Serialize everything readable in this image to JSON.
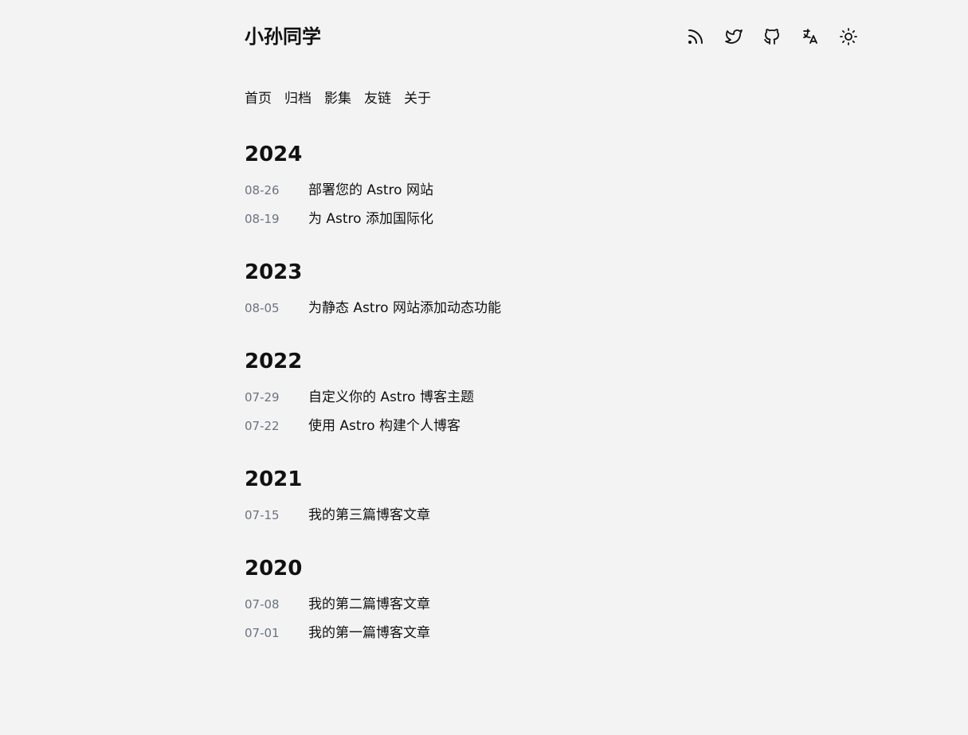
{
  "header": {
    "site_title": "小孙同学",
    "icons": [
      "rss-icon",
      "twitter-icon",
      "github-icon",
      "translate-icon",
      "sun-icon"
    ]
  },
  "nav": {
    "items": [
      {
        "label": "首页"
      },
      {
        "label": "归档"
      },
      {
        "label": "影集"
      },
      {
        "label": "友链"
      },
      {
        "label": "关于"
      }
    ]
  },
  "archive": {
    "years": [
      {
        "year": "2024",
        "posts": [
          {
            "date": "08-26",
            "title": "部署您的 Astro 网站"
          },
          {
            "date": "08-19",
            "title": "为 Astro 添加国际化"
          }
        ]
      },
      {
        "year": "2023",
        "posts": [
          {
            "date": "08-05",
            "title": "为静态 Astro 网站添加动态功能"
          }
        ]
      },
      {
        "year": "2022",
        "posts": [
          {
            "date": "07-29",
            "title": "自定义你的 Astro 博客主题"
          },
          {
            "date": "07-22",
            "title": "使用 Astro 构建个人博客"
          }
        ]
      },
      {
        "year": "2021",
        "posts": [
          {
            "date": "07-15",
            "title": "我的第三篇博客文章"
          }
        ]
      },
      {
        "year": "2020",
        "posts": [
          {
            "date": "07-08",
            "title": "我的第二篇博客文章"
          },
          {
            "date": "07-01",
            "title": "我的第一篇博客文章"
          }
        ]
      }
    ]
  }
}
